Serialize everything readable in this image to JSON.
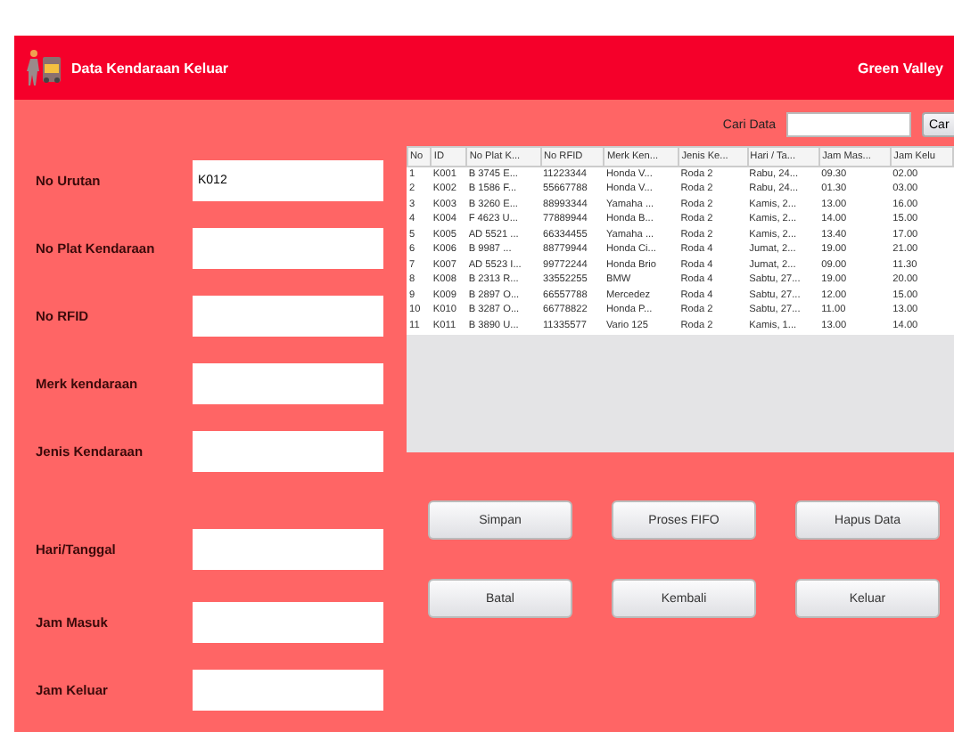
{
  "header": {
    "title": "Data Kendaraan Keluar",
    "brand": "Green Valley"
  },
  "search": {
    "label": "Cari Data",
    "button": "Car"
  },
  "form": [
    {
      "label": "No Urutan",
      "value": "K012"
    },
    {
      "label": "No Plat Kendaraan"
    },
    {
      "label": "No RFID"
    },
    {
      "label": "Merk kendaraan"
    },
    {
      "label": "Jenis Kendaraan"
    },
    {
      "label": "Hari/Tanggal"
    },
    {
      "label": "Jam Masuk"
    },
    {
      "label": "Jam Keluar"
    }
  ],
  "table": {
    "columns": [
      "No",
      "ID",
      "No Plat K...",
      "No RFID",
      "Merk Ken...",
      "Jenis Ke...",
      "Hari / Ta...",
      "Jam Mas...",
      "Jam Kelu"
    ],
    "rows": [
      [
        "1",
        "K001",
        "B 3745 E...",
        "11223344",
        "Honda V...",
        "Roda 2",
        "Rabu, 24...",
        "09.30",
        "02.00"
      ],
      [
        "2",
        "K002",
        "B 1586 F...",
        "55667788",
        "Honda V...",
        "Roda 2",
        "Rabu, 24...",
        "01.30",
        "03.00"
      ],
      [
        "3",
        "K003",
        "B 3260 E...",
        "88993344",
        "Yamaha ...",
        "Roda 2",
        "Kamis, 2...",
        "13.00",
        "16.00"
      ],
      [
        "4",
        "K004",
        "F 4623 U...",
        "77889944",
        "Honda B...",
        "Roda 2",
        "Kamis, 2...",
        "14.00",
        "15.00"
      ],
      [
        "5",
        "K005",
        "AD 5521 ...",
        "66334455",
        "Yamaha ...",
        "Roda 2",
        "Kamis, 2...",
        "13.40",
        "17.00"
      ],
      [
        "6",
        "K006",
        "B 9987 ...",
        "88779944",
        "Honda Ci...",
        "Roda 4",
        "Jumat, 2...",
        "19.00",
        "21.00"
      ],
      [
        "7",
        "K007",
        "AD 5523 I...",
        "99772244",
        "Honda Brio",
        "Roda 4",
        "Jumat, 2...",
        "09.00",
        "11.30"
      ],
      [
        "8",
        "K008",
        "B 2313 R...",
        "33552255",
        "BMW",
        "Roda 4",
        "Sabtu, 27...",
        "19.00",
        "20.00"
      ],
      [
        "9",
        "K009",
        "B 2897 O...",
        "66557788",
        "Mercedez",
        "Roda 4",
        "Sabtu, 27...",
        "12.00",
        "15.00"
      ],
      [
        "10",
        "K010",
        "B 3287 O...",
        "66778822",
        "Honda P...",
        "Roda 2",
        "Sabtu, 27...",
        "11.00",
        "13.00"
      ],
      [
        "11",
        "K011",
        "B 3890 U...",
        "11335577",
        "Vario 125",
        "Roda 2",
        "Kamis, 1...",
        "13.00",
        "14.00"
      ]
    ]
  },
  "buttons": [
    "Simpan",
    "Proses FIFO",
    "Hapus Data",
    "Batal",
    "Kembali",
    "Keluar"
  ]
}
